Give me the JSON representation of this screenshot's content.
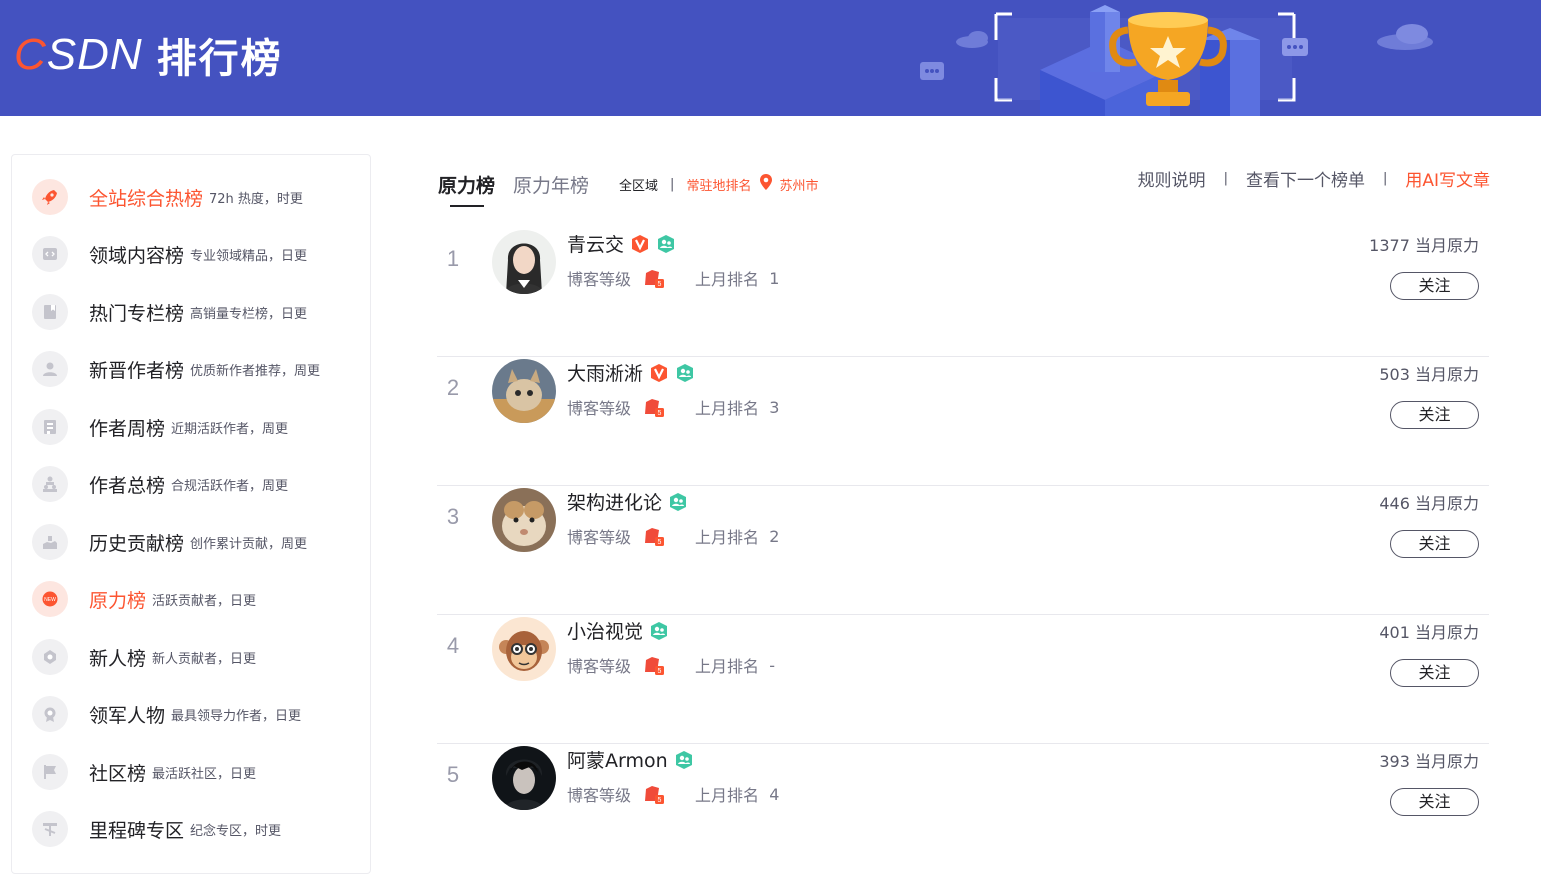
{
  "header": {
    "logo_text": "CSDN",
    "title": "排行榜"
  },
  "sidebar": {
    "items": [
      {
        "label": "全站综合热榜",
        "desc": "72h 热度，时更",
        "icon": "rocket-icon",
        "active": true
      },
      {
        "label": "领域内容榜",
        "desc": "专业领域精品，日更",
        "icon": "code-icon"
      },
      {
        "label": "热门专栏榜",
        "desc": "高销量专栏榜，日更",
        "icon": "book-icon"
      },
      {
        "label": "新晋作者榜",
        "desc": "优质新作者推荐，周更",
        "icon": "user-icon"
      },
      {
        "label": "作者周榜",
        "desc": "近期活跃作者，周更",
        "icon": "calendar-icon"
      },
      {
        "label": "作者总榜",
        "desc": "合规活跃作者，周更",
        "icon": "users-icon"
      },
      {
        "label": "历史贡献榜",
        "desc": "创作累计贡献，周更",
        "icon": "hand-icon"
      },
      {
        "label": "原力榜",
        "desc": "活跃贡献者，日更",
        "icon": "new-icon",
        "highlight": true
      },
      {
        "label": "新人榜",
        "desc": "新人贡献者，日更",
        "icon": "badge-icon"
      },
      {
        "label": "领军人物",
        "desc": "最具领导力作者，日更",
        "icon": "medal-icon"
      },
      {
        "label": "社区榜",
        "desc": "最活跃社区，日更",
        "icon": "flag-icon"
      },
      {
        "label": "里程碑专区",
        "desc": "纪念专区，时更",
        "icon": "milestone-icon"
      }
    ]
  },
  "tabs": {
    "tab1": "原力榜",
    "tab2": "原力年榜"
  },
  "filters": {
    "region": "全区域",
    "separator": "|",
    "resident_rank": "常驻地排名",
    "city": "苏州市"
  },
  "toplinks": {
    "rules": "规则说明",
    "next": "查看下一个榜单",
    "ai": "用AI写文章",
    "divider": "|"
  },
  "ranking": {
    "level_label": "博客等级",
    "last_month_label": "上月排名",
    "power_suffix": "当月原力",
    "follow_label": "关注",
    "rows": [
      {
        "rank": "1",
        "name": "青云交",
        "verified": true,
        "last_rank": "1",
        "power": "1377"
      },
      {
        "rank": "2",
        "name": "大雨淅淅",
        "verified": true,
        "last_rank": "3",
        "power": "503"
      },
      {
        "rank": "3",
        "name": "架构进化论",
        "verified": false,
        "last_rank": "2",
        "power": "446"
      },
      {
        "rank": "4",
        "name": "小治视觉",
        "verified": false,
        "last_rank": "-",
        "power": "401"
      },
      {
        "rank": "5",
        "name": "阿蒙Armon",
        "verified": false,
        "last_rank": "4",
        "power": "393"
      }
    ]
  },
  "colors": {
    "banner": "#4452c0",
    "accent": "#fc5531",
    "text": "#222226",
    "muted": "#777888"
  }
}
